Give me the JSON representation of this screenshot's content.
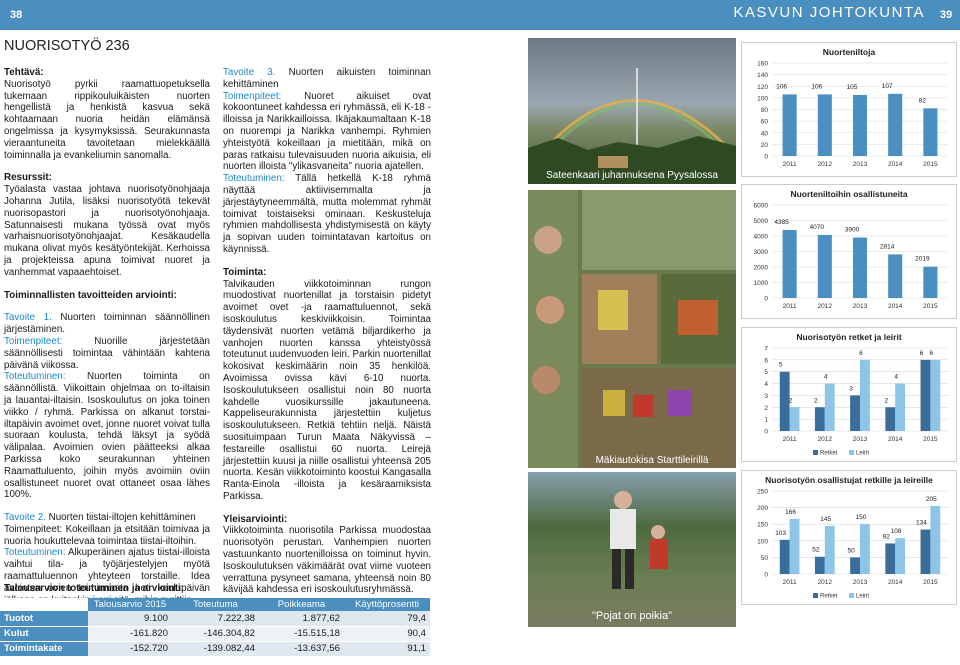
{
  "header": {
    "left_page_number": "38",
    "running_head": "KASVUN JOHTOKUNTA",
    "right_page_number": "39"
  },
  "section_title": "NUORISOTYÖ 236",
  "left_col": {
    "task_label": "Tehtävä:",
    "task_text": "Nuorisotyö pyrkii raamattuopetuksella tukemaan rippikouluikäisten nuorten hengellistä ja henkistä kasvua sekä kohtaamaan nuoria heidän elämänsä ongelmissa ja kysymyksissä. Seurakunnasta vieraantuneita tavoitetaan mielekkäällä toiminnalla ja evankeliumin sanomalla.",
    "resources_label": "Resurssit:",
    "resources_text": "Työalasta vastaa johtava nuorisotyönohjaaja Johanna Jutila, lisäksi nuorisotyötä tekevät nuorisopastori ja nuorisotyönohjaaja. Satunnaisesti mukana työssä ovat myös varhaisnuorisotyönohjaajat. Kesäkaudella mukana olivat myös kesätyöntekijät. Kerhoissa ja projekteissa apuna toimivat nuoret ja vanhemmat vapaaehtoiset.",
    "eval_heading": "Toiminnallisten tavoitteiden arviointi:",
    "goal1_label": "Tavoite 1.",
    "goal1_title": " Nuorten toiminnan säännöllinen järjestäminen.",
    "goal1_measures_label": "Toimenpiteet:",
    "goal1_measures": " Nuorille järjestetään säännöllisesti toimintaa vähintään kahtena päivänä viikossa.",
    "goal1_realized_label": "Toteutuminen:",
    "goal1_realized": " Nuorten toiminta on säännöllistä. Viikoittain ohjelmaa on to-iltaisin ja lauantai-iltaisin. Isoskoulutus on joka toinen viikko / ryhmä. Parkissa on alkanut torstai-iltapäivin avoimet ovet, jonne nuoret voivat tulla suoraan koulusta, tehdä läksyt ja syödä välipalaa. Avoimien ovien päätteeksi alkaa Parkissa koko seurakunnan yhteinen Raamattuluento, joihin myös avoimiin oviin osallistuneet nuoret ovat ottaneet osaa lähes 100%.",
    "goal2_label": "Tavoite 2.",
    "goal2_title": " Nuorten tiistai-iltojen kehittäminen",
    "goal2_measures": "Toimenpiteet: Kokeillaan ja etsitään toimivaa ja nuoria houkuttelevaa toimintaa tiistai-iltoihin.",
    "goal2_realized_label": "Toteutuminen:",
    "goal2_realized": " Alkuperäinen ajatus tiistai-illoista vaihtui tila- ja työjärjestelyjen myötä raamattuluennon yhteyteen torstaille. Idea avointen ovien toiminnasta heti koulupäivän jälkeen on kuitenkin juuri sitä, mihin pyrittiin."
  },
  "budget": {
    "heading": "Talousarvion toteutuminen ja arviointi:",
    "columns": [
      "",
      "Talousarvio 2015",
      "Toteutuma",
      "Poikkeama",
      "Käyttöprosentti"
    ],
    "rows": [
      [
        "Tuotot",
        "9.100",
        "7.222,38",
        "1.877,62",
        "79,4"
      ],
      [
        "Kulut",
        "-161.820",
        "-146.304,82",
        "-15.515,18",
        "90,4"
      ],
      [
        "Toimintakate",
        "-152.720",
        "-139.082,44",
        "-13.637,56",
        "91,1"
      ]
    ]
  },
  "mid_col": {
    "goal3_label": "Tavoite 3.",
    "goal3_title": " Nuorten aikuisten toiminnan kehittäminen",
    "goal3_measures_label": "Toimenpiteet:",
    "goal3_measures": " Nuoret aikuiset ovat kokoontuneet kahdessa eri ryhmässä, eli K-18 -illoissa ja Narikkailloissa. Ikäjakaumaltaan K-18 on nuorempi ja Narikka vanhempi. Ryhmien yhteistyötä kokeillaan ja mietitään, mikä on paras ratkaisu tulevaisuuden nuoria aikuisia, eli nuorten illoista \"ylikasvaneita\" nuoria ajatellen.",
    "goal3_realized_label": "Toteutuminen:",
    "goal3_realized": " Tällä hetkellä K-18 ryhmä näyttää aktiivisemmalta ja järjestäytyneemmältä, mutta molemmat ryhmät toimivat toistaiseksi ominaan. Keskusteluja ryhmien mahdollisesta yhdistymisestä on käyty ja sopivan uuden toimintatavan kartoitus on käynnissä.",
    "ops_label": "Toiminta:",
    "ops_text": "Talvikauden viikkotoiminnan rungon muodostivat nuortenillat ja torstaisin pidetyt avoimet ovet -ja raamattuluennot, sekä isoskoulutus keskiviikkoisin. Toimintaa täydensivät nuorten vetämä biljardikerho ja vanhojen nuorten kanssa yhteistyössä toteutunut uudenvuoden leiri. Parkin nuortenillat kokosivat keskimäärin noin 35 henkilöä. Avoimissa ovissa kävi 6-10 nuorta. Isoskoulutukseen osallistui noin 80 nuorta kahdelle vuosikurssille jakautuneena. Kappeliseurakunnista järjestettiin kuljetus isoskoulutukseen. Retkiä tehtiin neljä. Näistä suosituimpaan Turun Maata Näkyvissä –festareille osallistui 60 nuorta. Leirejä järjestettiin kuusi ja niille osallistui yhteensä 205 nuorta. Kesän viikkotoiminto koostui Kangasalla Ranta-Einola -illoista ja kesäraamiksista Parkissa.",
    "summary_label": "Yleisarviointi:",
    "summary_text": "Viikkotoiminta nuorisotila Parkissa muodostaa nuorisotyön perustan. Vanhempien nuorten vastuunkanto nuortenilloissa on toiminut hyvin. Isoskoulutuksen väkimäärät ovat viime vuoteen verrattuna pysyneet samana, yhteensä noin 80 kävijää kahdessa eri isoskoulutusryhmässä."
  },
  "photos": {
    "caption1": "Sateenkaari juhannuksena Pyysalossa",
    "caption2": "Mäkiautokisa Starttileirillä",
    "caption3": "\"Pojat on poikia\""
  },
  "charts": [
    {
      "chart_data": {
        "type": "bar",
        "title": "Nuorteniltoja",
        "categories": [
          "2011",
          "2012",
          "2013",
          "2014",
          "2015"
        ],
        "values": [
          106,
          106,
          105,
          107,
          82
        ],
        "yticks": [
          0,
          20,
          40,
          60,
          80,
          100,
          120,
          140,
          160
        ],
        "ylim": [
          0,
          160
        ],
        "color": "#4a8fc0"
      }
    },
    {
      "chart_data": {
        "type": "bar",
        "title": "Nuorteniltoihin osallistuneita",
        "categories": [
          "2011",
          "2012",
          "2013",
          "2014",
          "2015"
        ],
        "values": [
          4385,
          4070,
          3900,
          2814,
          2019
        ],
        "yticks": [
          0,
          1000,
          2000,
          3000,
          4000,
          5000,
          6000
        ],
        "ylim": [
          0,
          6000
        ],
        "color": "#4a8fc0"
      }
    },
    {
      "chart_data": {
        "type": "bar",
        "title": "Nuorisotyön retket ja leirit",
        "categories": [
          "2011",
          "2012",
          "2013",
          "2014",
          "2015"
        ],
        "series": [
          {
            "name": "Retket",
            "values": [
              5,
              2,
              3,
              2,
              6
            ],
            "color": "#3a6d99"
          },
          {
            "name": "Leirit",
            "values": [
              2,
              4,
              6,
              4,
              6
            ],
            "color": "#8ec4e8"
          }
        ],
        "yticks": [
          0,
          1,
          2,
          3,
          4,
          5,
          6,
          7
        ],
        "ylim": [
          0,
          7
        ],
        "legend": "bottom"
      }
    },
    {
      "chart_data": {
        "type": "bar",
        "title": "Nuorisotyön osallistujat retkille ja leireille",
        "categories": [
          "2011",
          "2012",
          "2013",
          "2014",
          "2015"
        ],
        "series": [
          {
            "name": "Retket",
            "values": [
              103,
              52,
              50,
              92,
              134
            ],
            "color": "#3a6d99"
          },
          {
            "name": "Leirit",
            "values": [
              166,
              145,
              150,
              108,
              205
            ],
            "color": "#8ec4e8"
          }
        ],
        "yticks": [
          0,
          50,
          100,
          150,
          200,
          250
        ],
        "ylim": [
          0,
          250
        ],
        "legend": "bottom"
      }
    }
  ]
}
